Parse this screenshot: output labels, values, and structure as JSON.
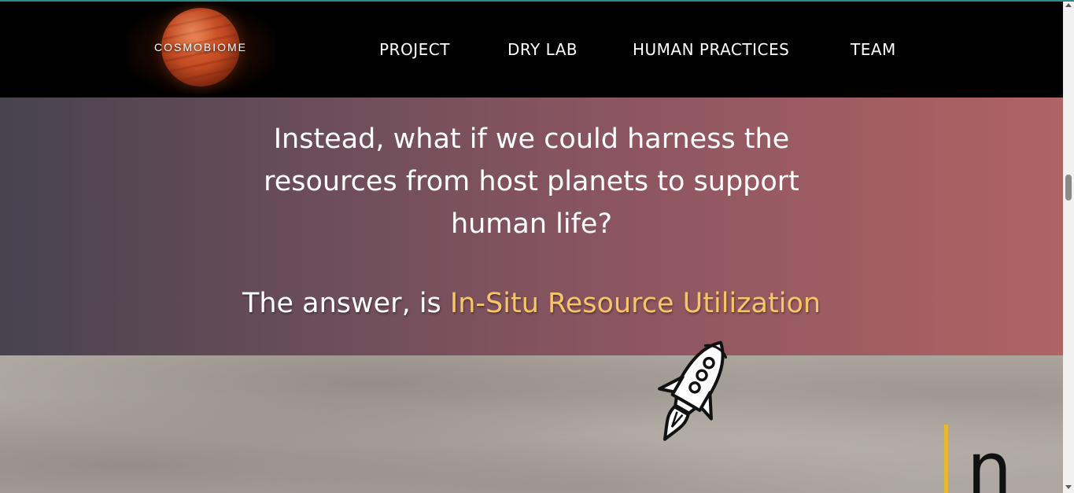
{
  "logo": {
    "text": "COSMOBIOME"
  },
  "nav": {
    "items": [
      {
        "label": "PROJECT"
      },
      {
        "label": "DRY LAB"
      },
      {
        "label": "HUMAN PRACTICES"
      },
      {
        "label": "TEAM"
      }
    ]
  },
  "hero": {
    "question_lines": [
      "Instead, what if we could harness the",
      "resources from host planets to support",
      "human life?"
    ],
    "answer_prefix": "The answer, is ",
    "answer_highlight": "In-Situ Resource Utilization"
  },
  "surface": {
    "typed_letter": "n"
  },
  "colors": {
    "highlight": "#f7c56a",
    "gradient_start": "#47434f",
    "gradient_end": "#b06363",
    "typing_cursor": "#e7b92e"
  },
  "icons": {
    "rocket": "rocket-icon"
  }
}
